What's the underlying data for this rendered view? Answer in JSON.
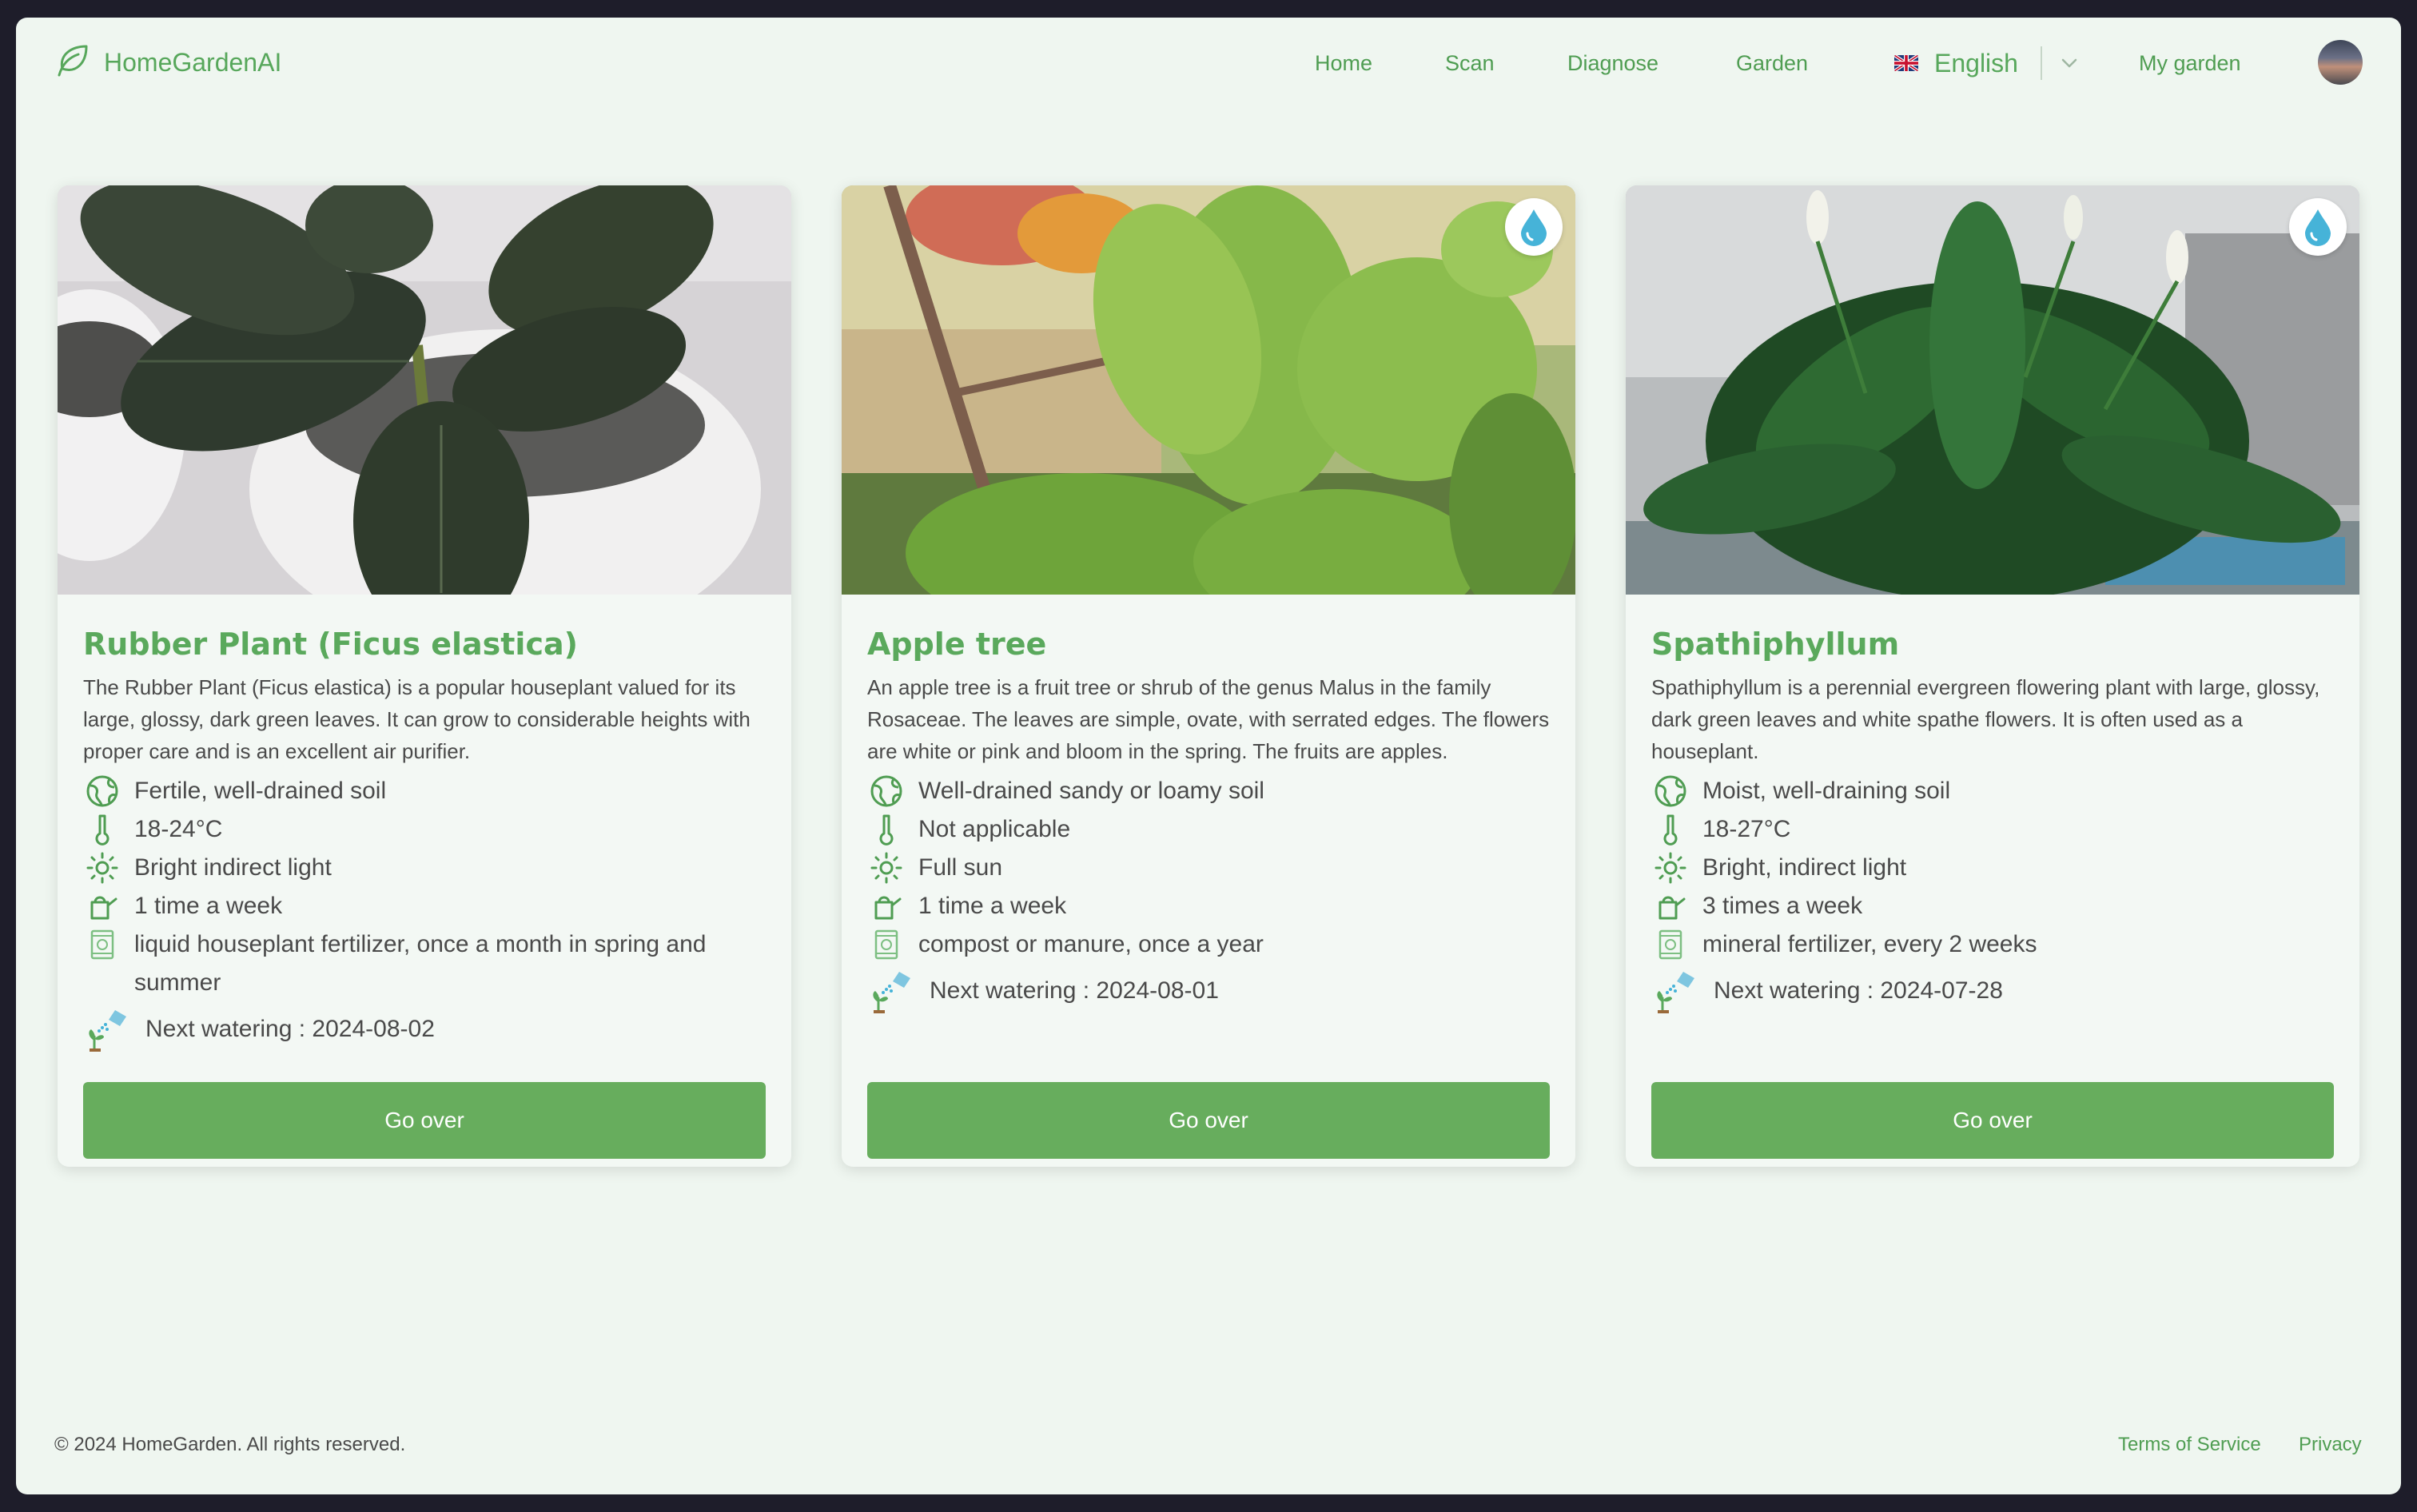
{
  "header": {
    "brand": "HomeGardenAI",
    "nav": [
      "Home",
      "Scan",
      "Diagnose",
      "Garden"
    ],
    "language": "English",
    "my_garden": "My garden"
  },
  "plants": [
    {
      "title": "Rubber Plant (Ficus elastica)",
      "description": "The Rubber Plant (Ficus elastica) is a popular houseplant valued for its large, glossy, dark green leaves. It can grow to considerable heights with proper care and is an excellent air purifier.",
      "soil": "Fertile, well-drained soil",
      "temperature": "18-24°C",
      "light": "Bright indirect light",
      "watering": "1 time a week",
      "fertilizer": "liquid houseplant fertilizer, once a month in spring and summer",
      "next_watering": "Next watering : 2024-08-02",
      "button": "Go over"
    },
    {
      "title": "Apple tree",
      "description": "An apple tree is a fruit tree or shrub of the genus Malus in the family Rosaceae. The leaves are simple, ovate, with serrated edges. The flowers are white or pink and bloom in the spring. The fruits are apples.",
      "soil": "Well-drained sandy or loamy soil",
      "temperature": "Not applicable",
      "light": "Full sun",
      "watering": "1 time a week",
      "fertilizer": "compost or manure, once a year",
      "next_watering": "Next watering : 2024-08-01",
      "button": "Go over"
    },
    {
      "title": "Spathiphyllum",
      "description": "Spathiphyllum is a perennial evergreen flowering plant with large, glossy, dark green leaves and white spathe flowers. It is often used as a houseplant.",
      "soil": "Moist, well-draining soil",
      "temperature": "18-27°C",
      "light": "Bright, indirect light",
      "watering": "3 times a week",
      "fertilizer": "mineral fertilizer, every 2 weeks",
      "next_watering": "Next watering : 2024-07-28",
      "button": "Go over"
    }
  ],
  "footer": {
    "copyright": "© 2024 HomeGarden. All rights reserved.",
    "terms": "Terms of Service",
    "privacy": "Privacy"
  },
  "icons": {
    "brand": "leaf-icon",
    "soil": "soil-globe-icon",
    "temperature": "thermometer-icon",
    "light": "sun-icon",
    "watering": "watering-can-icon",
    "fertilizer": "fertilizer-bag-icon",
    "next_watering": "watering-sprout-icon",
    "watering_due": "water-drop-icon",
    "language": "uk-flag-icon"
  },
  "colors": {
    "accent": "#5aa95c",
    "button": "#67ad5d",
    "background": "#eff6f0",
    "water_drop": "#46b3d8"
  }
}
